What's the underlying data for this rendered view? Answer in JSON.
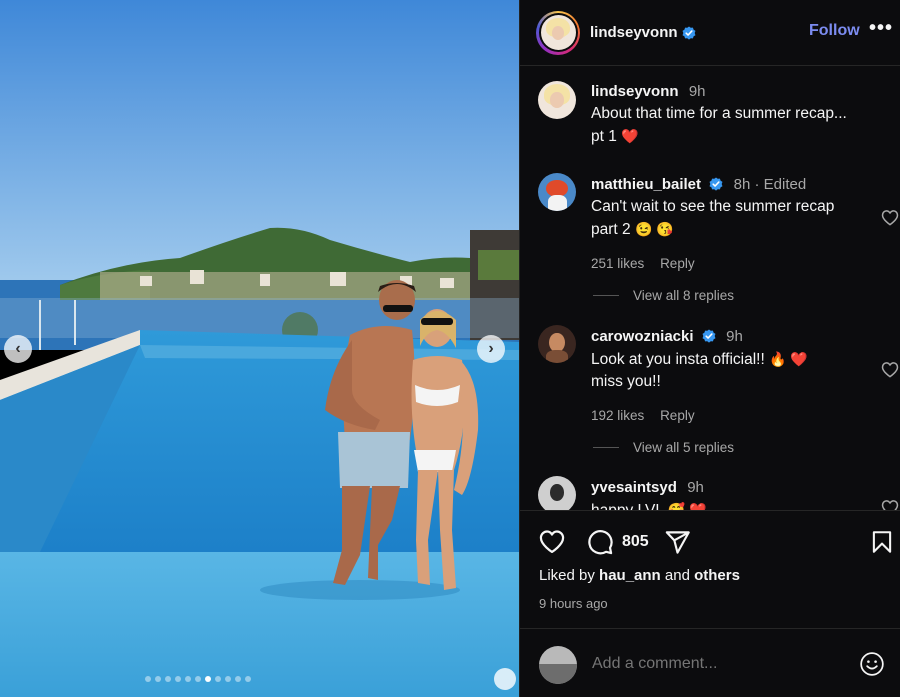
{
  "post": {
    "author": "lindseyvonn",
    "follow_label": "Follow",
    "more_label": "•••",
    "caption": {
      "username": "lindseyvonn",
      "time": "9h",
      "text": "About that time for a summer recap... pt 1",
      "emoji": "❤️"
    },
    "carousel": {
      "total_slides": 11,
      "active_slide": 7,
      "prev_glyph": "‹",
      "next_glyph": "›"
    }
  },
  "comments": [
    {
      "username": "matthieu_bailet",
      "verified": true,
      "time": "8h · Edited",
      "text": "Can't wait to see the summer recap part 2",
      "emoji": "😉 😘",
      "likes": "251 likes",
      "reply_label": "Reply",
      "view_replies": "View all 8 replies"
    },
    {
      "username": "carowozniacki",
      "verified": true,
      "time": "9h",
      "text": "Look at you insta official!!",
      "emoji": "🔥 ❤️",
      "text2": "miss you!!",
      "likes": "192 likes",
      "reply_label": "Reply",
      "view_replies": "View all 5 replies"
    },
    {
      "username": "yvesaintsyd",
      "verified": false,
      "time": "9h",
      "text": "happy LVL",
      "emoji": "🥰 ❤️"
    }
  ],
  "actions": {
    "comment_count": "805",
    "liked_by_prefix": "Liked by",
    "liked_by_user": "hau_ann",
    "liked_by_and": "and",
    "liked_by_others": "others",
    "timestamp": "9 hours ago"
  },
  "compose": {
    "placeholder": "Add a comment..."
  },
  "icons": {
    "verified": "verified-badge-icon",
    "like": "heart-icon",
    "comment": "comment-bubble-icon",
    "share": "paper-plane-icon",
    "save": "bookmark-icon",
    "emoji_picker": "smiley-face-icon"
  },
  "colors": {
    "follow": "#7c8cf0",
    "verified": "#3797f0",
    "muted_text": "#a8a8a8",
    "panel_bg": "#0c0c0e"
  }
}
